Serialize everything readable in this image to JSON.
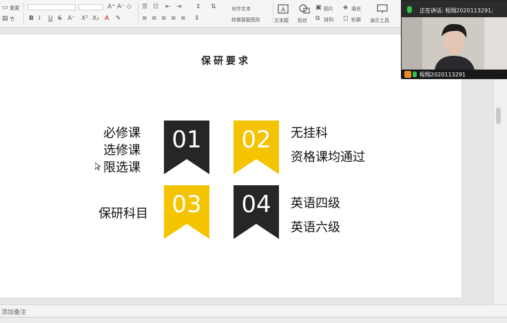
{
  "ribbon": {
    "reset_label": "重置",
    "section_label": "节",
    "font_bold": "B",
    "font_italic": "I",
    "font_underline": "U",
    "font_strike": "S",
    "align_text_label": "对齐文本",
    "smartart_label": "转换智能图形",
    "textbox_label": "文本框",
    "shape_label": "形状",
    "picture_label": "图片",
    "fill_label": "填充",
    "arrange_label": "排列",
    "outline_label": "轮廓",
    "presenter_tools_label": "演示工具"
  },
  "slide": {
    "title": "保研要求",
    "items": [
      {
        "number": "01",
        "left_lines": [
          "必修课",
          "选修课",
          "限选课"
        ]
      },
      {
        "number": "02",
        "right_lines": [
          "无挂科",
          "资格课均通过"
        ]
      },
      {
        "number": "03",
        "left_lines": [
          "保研科目"
        ]
      },
      {
        "number": "04",
        "right_lines": [
          "英语四级",
          "英语六级"
        ]
      }
    ]
  },
  "notes": {
    "placeholder": "添加备注"
  },
  "webcam": {
    "speaking_text": "正在讲话: 程翔2020113291;",
    "name_text": "程翔2020113291"
  },
  "colors": {
    "dark_flag": "#262626",
    "yellow_flag": "#f5c400",
    "mic_green": "#2ec24a"
  }
}
